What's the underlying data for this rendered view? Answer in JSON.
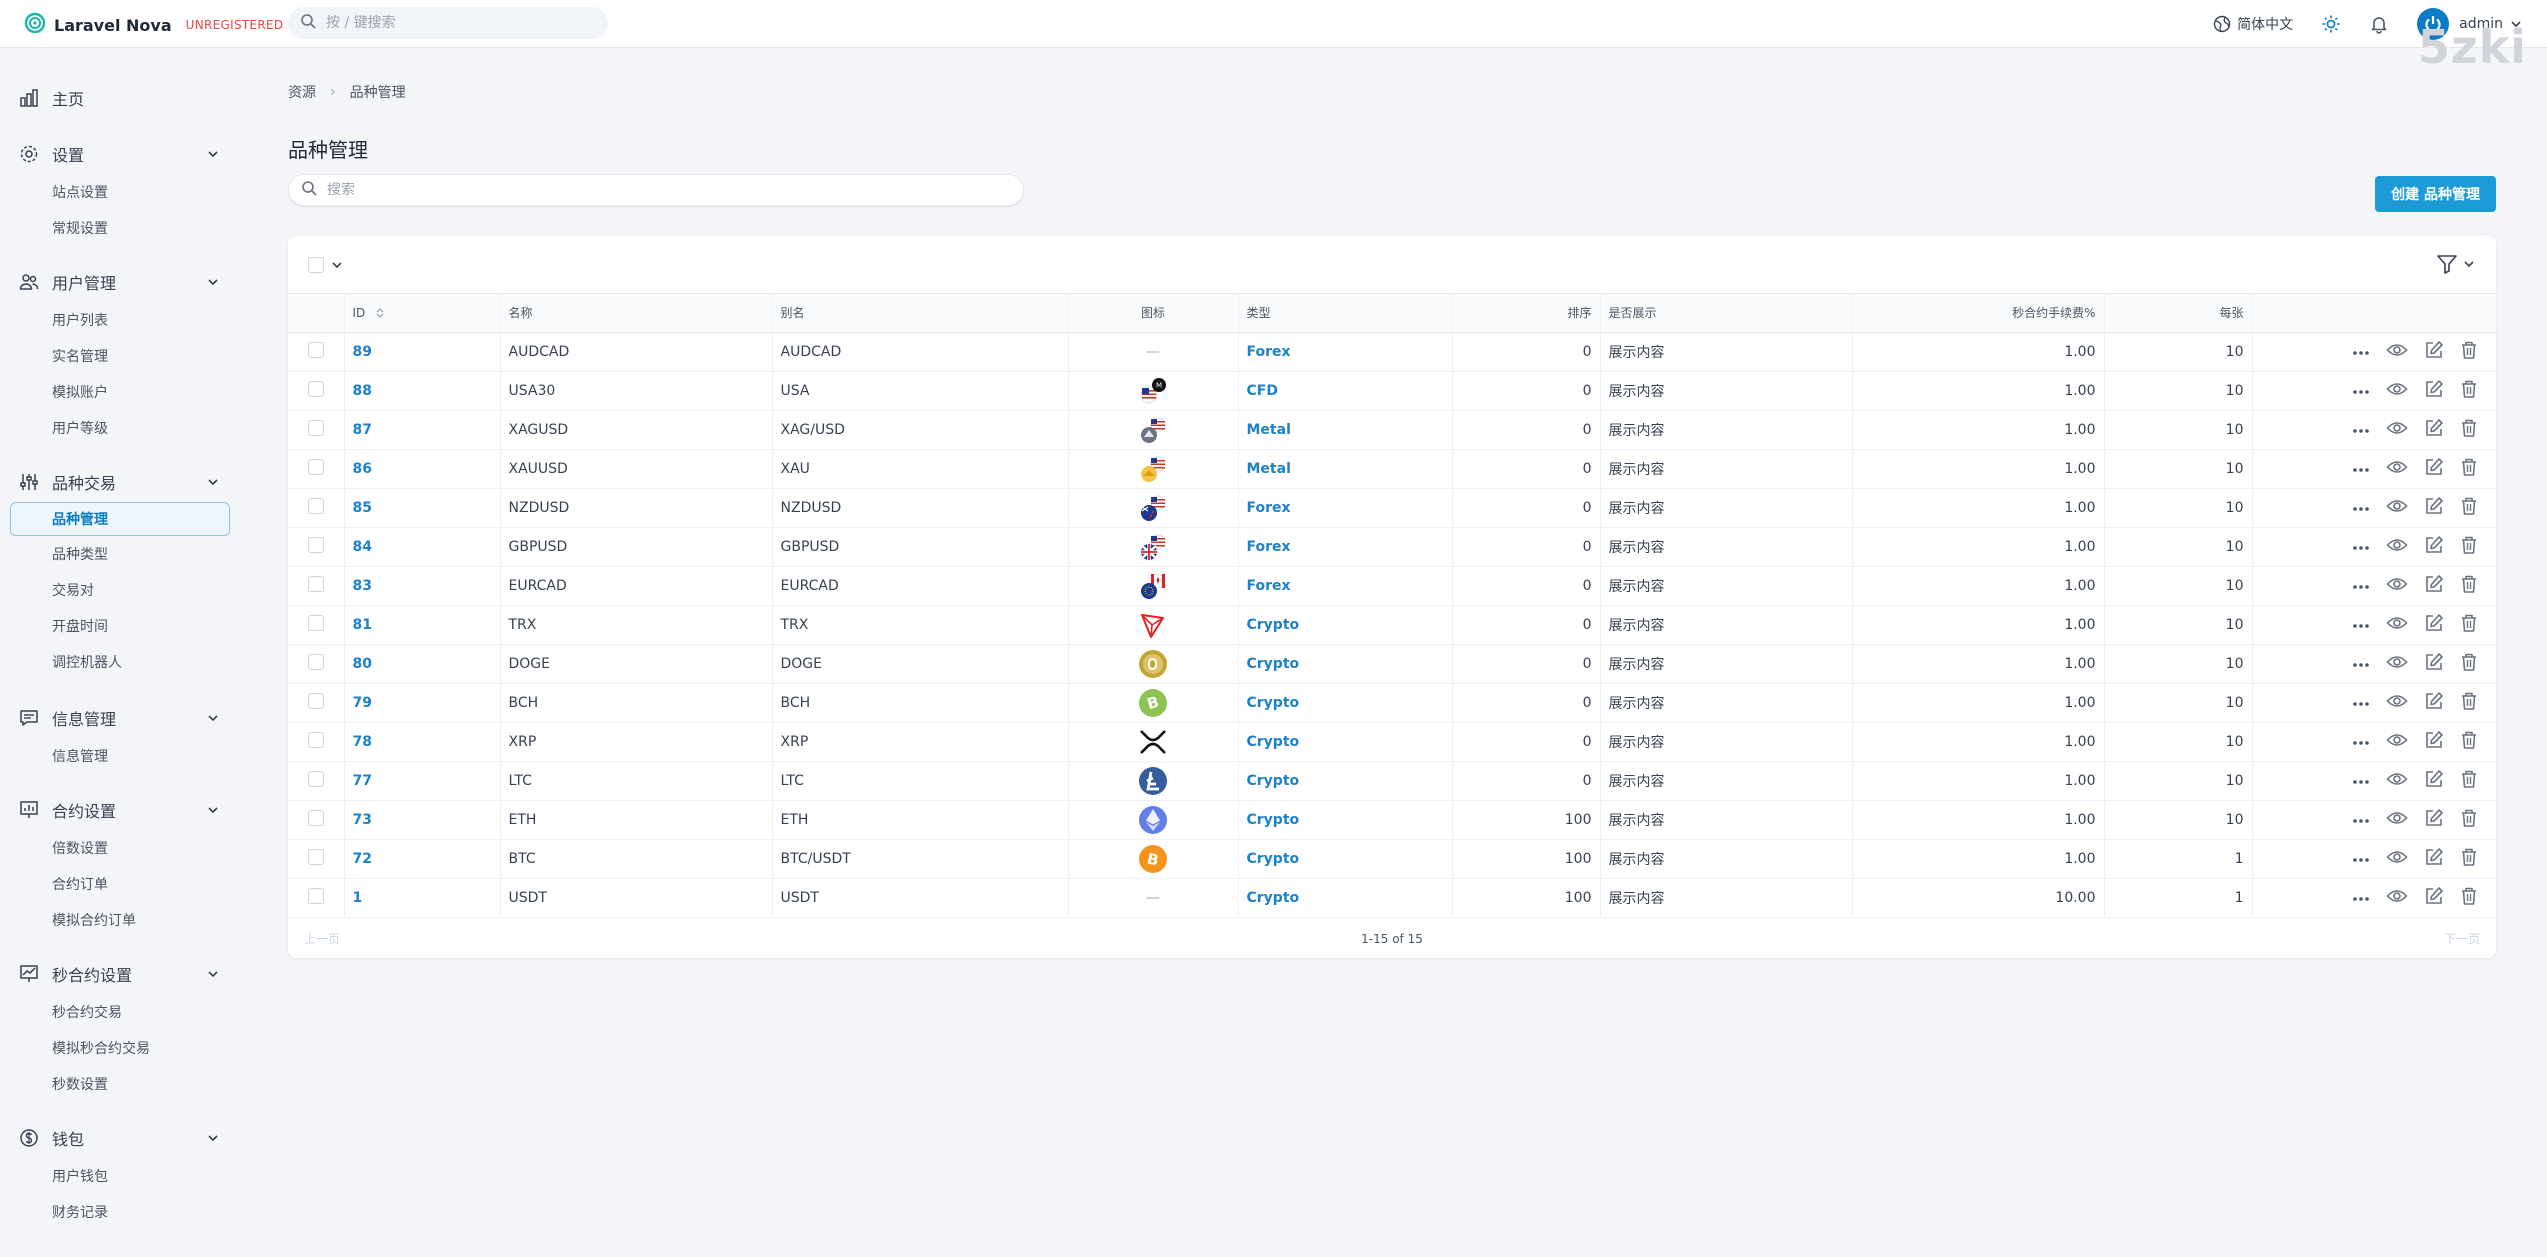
{
  "topbar": {
    "brand_name": "Laravel Nova",
    "brand_tag": "UNREGISTERED",
    "search_placeholder": "按 / 键搜索",
    "language": "简体中文",
    "user_name": "admin",
    "watermark": "5zki"
  },
  "sidebar": {
    "dashboard": "主页",
    "groups": [
      {
        "label": "设置",
        "items": [
          "站点设置",
          "常规设置"
        ]
      },
      {
        "label": "用户管理",
        "items": [
          "用户列表",
          "实名管理",
          "模拟账户",
          "用户等级"
        ]
      },
      {
        "label": "品种交易",
        "items": [
          "品种管理",
          "品种类型",
          "交易对",
          "开盘时间",
          "调控机器人"
        ]
      },
      {
        "label": "信息管理",
        "items": [
          "信息管理"
        ]
      },
      {
        "label": "合约设置",
        "items": [
          "倍数设置",
          "合约订单",
          "模拟合约订单"
        ]
      },
      {
        "label": "秒合约设置",
        "items": [
          "秒合约交易",
          "模拟秒合约交易",
          "秒数设置"
        ]
      },
      {
        "label": "钱包",
        "items": [
          "用户钱包",
          "财务记录"
        ]
      }
    ]
  },
  "main": {
    "breadcrumb": [
      "资源",
      "品种管理"
    ],
    "title": "品种管理",
    "search_placeholder": "搜索",
    "create_label": "创建 品种管理",
    "columns": {
      "id": "ID",
      "name": "名称",
      "alias": "别名",
      "icon": "图标",
      "type": "类型",
      "sort": "排序",
      "show": "是否展示",
      "fee": "秒合约手续费%",
      "per": "每张"
    },
    "rows": [
      {
        "id": "89",
        "name": "AUDCAD",
        "alias": "AUDCAD",
        "icon": "none",
        "type": "Forex",
        "sort": "0",
        "show": "展示内容",
        "fee": "1.00",
        "per": "10"
      },
      {
        "id": "88",
        "name": "USA30",
        "alias": "USA",
        "icon": "flag-us-icon",
        "type": "CFD",
        "sort": "0",
        "show": "展示内容",
        "fee": "1.00",
        "per": "10"
      },
      {
        "id": "87",
        "name": "XAGUSD",
        "alias": "XAG/USD",
        "icon": "silver-usd-icon",
        "type": "Metal",
        "sort": "0",
        "show": "展示内容",
        "fee": "1.00",
        "per": "10"
      },
      {
        "id": "86",
        "name": "XAUUSD",
        "alias": "XAU",
        "icon": "gold-usd-icon",
        "type": "Metal",
        "sort": "0",
        "show": "展示内容",
        "fee": "1.00",
        "per": "10"
      },
      {
        "id": "85",
        "name": "NZDUSD",
        "alias": "NZDUSD",
        "icon": "nzd-usd-flags-icon",
        "type": "Forex",
        "sort": "0",
        "show": "展示内容",
        "fee": "1.00",
        "per": "10"
      },
      {
        "id": "84",
        "name": "GBPUSD",
        "alias": "GBPUSD",
        "icon": "gbp-usd-flags-icon",
        "type": "Forex",
        "sort": "0",
        "show": "展示内容",
        "fee": "1.00",
        "per": "10"
      },
      {
        "id": "83",
        "name": "EURCAD",
        "alias": "EURCAD",
        "icon": "eur-cad-flags-icon",
        "type": "Forex",
        "sort": "0",
        "show": "展示内容",
        "fee": "1.00",
        "per": "10"
      },
      {
        "id": "81",
        "name": "TRX",
        "alias": "TRX",
        "icon": "tron-icon",
        "type": "Crypto",
        "sort": "0",
        "show": "展示内容",
        "fee": "1.00",
        "per": "10"
      },
      {
        "id": "80",
        "name": "DOGE",
        "alias": "DOGE",
        "icon": "doge-icon",
        "type": "Crypto",
        "sort": "0",
        "show": "展示内容",
        "fee": "1.00",
        "per": "10"
      },
      {
        "id": "79",
        "name": "BCH",
        "alias": "BCH",
        "icon": "bch-icon",
        "type": "Crypto",
        "sort": "0",
        "show": "展示内容",
        "fee": "1.00",
        "per": "10"
      },
      {
        "id": "78",
        "name": "XRP",
        "alias": "XRP",
        "icon": "xrp-icon",
        "type": "Crypto",
        "sort": "0",
        "show": "展示内容",
        "fee": "1.00",
        "per": "10"
      },
      {
        "id": "77",
        "name": "LTC",
        "alias": "LTC",
        "icon": "ltc-icon",
        "type": "Crypto",
        "sort": "0",
        "show": "展示内容",
        "fee": "1.00",
        "per": "10"
      },
      {
        "id": "73",
        "name": "ETH",
        "alias": "ETH",
        "icon": "eth-icon",
        "type": "Crypto",
        "sort": "100",
        "show": "展示内容",
        "fee": "1.00",
        "per": "10"
      },
      {
        "id": "72",
        "name": "BTC",
        "alias": "BTC/USDT",
        "icon": "btc-icon",
        "type": "Crypto",
        "sort": "100",
        "show": "展示内容",
        "fee": "1.00",
        "per": "1"
      },
      {
        "id": "1",
        "name": "USDT",
        "alias": "USDT",
        "icon": "none",
        "type": "Crypto",
        "sort": "100",
        "show": "展示内容",
        "fee": "10.00",
        "per": "1"
      }
    ],
    "no_icon": "—",
    "pagination": {
      "prev": "上一页",
      "status": "1-15 of 15",
      "next": "下一页"
    }
  },
  "colors": {
    "accent": "#1d82c7",
    "button": "#1d9bd7",
    "unregistered": "#ef4444"
  }
}
